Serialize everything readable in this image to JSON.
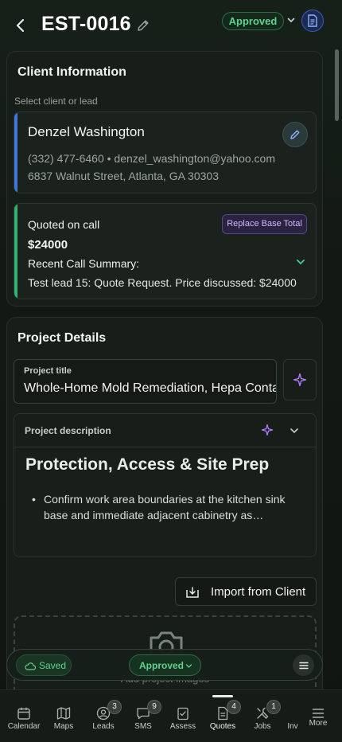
{
  "header": {
    "estimate_id": "EST-0016",
    "status": "Approved"
  },
  "client_section": {
    "title": "Client Information",
    "select_label": "Select client or lead",
    "client": {
      "name": "Denzel Washington",
      "contact": "(332) 477-6460 • denzel_washington@yahoo.com",
      "address": "6837 Walnut Street, Atlanta, GA 30303"
    },
    "quote": {
      "label": "Quoted on call",
      "amount": "$24000",
      "replace_button": "Replace Base Total",
      "summary_label": "Recent Call Summary:",
      "summary_text": "Test lead 15: Quote Request. Price discussed: $24000"
    }
  },
  "project_section": {
    "title": "Project Details",
    "project_title_label": "Project title",
    "project_title_value": "Whole-Home Mold Remediation, Hepa Containment",
    "description_label": "Project description",
    "description_heading": "Protection, Access & Site Prep",
    "description_bullet": "Confirm work area boundaries at the kitchen sink base and immediate adjacent cabinetry as…",
    "import_button": "Import from Client",
    "upload_text": "Add project images"
  },
  "action_bar": {
    "saved_label": "Saved",
    "status_label": "Approved"
  },
  "bottom_nav": [
    {
      "label": "Calendar",
      "icon": "calendar-icon"
    },
    {
      "label": "Maps",
      "icon": "map-icon"
    },
    {
      "label": "Leads",
      "icon": "leads-icon",
      "badge": "3"
    },
    {
      "label": "SMS",
      "icon": "chat-icon",
      "badge": "9"
    },
    {
      "label": "Assess",
      "icon": "assess-icon"
    },
    {
      "label": "Quotes",
      "icon": "quotes-icon",
      "badge": "4",
      "active": true
    },
    {
      "label": "Jobs",
      "icon": "jobs-icon",
      "badge": "1"
    },
    {
      "label": "Inv",
      "icon": "invoice-icon"
    },
    {
      "label": "More",
      "icon": "menu-icon"
    }
  ],
  "colors": {
    "approved_green": "#5fd38d",
    "client_accent": "#3f78d8",
    "quote_accent": "#2fb170",
    "ai_purple": "#b07cff"
  }
}
